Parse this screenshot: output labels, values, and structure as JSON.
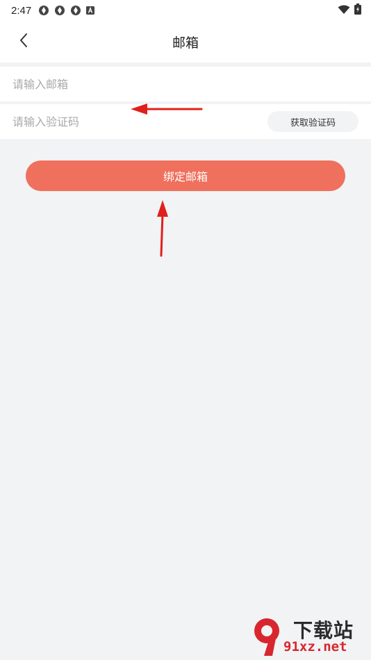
{
  "status_bar": {
    "time": "2:47",
    "left_icons": [
      "aperture-icon",
      "aperture-icon",
      "aperture-icon",
      "keyboard-a-icon"
    ],
    "right_icons": [
      "wifi-icon",
      "battery-charging-icon"
    ]
  },
  "nav": {
    "title": "邮箱",
    "back_icon": "chevron-left-icon"
  },
  "form": {
    "email_placeholder": "请输入邮箱",
    "email_value": "",
    "code_placeholder": "请输入验证码",
    "code_value": "",
    "get_code_label": "获取验证码"
  },
  "bind_button_label": "绑定邮箱",
  "watermark": {
    "text": "下载站",
    "url": "91xz.net"
  },
  "colors": {
    "accent": "#ef705d",
    "background": "#f1f3f5",
    "annotation_arrow": "#e0201a",
    "watermark_red": "#d8262f"
  }
}
